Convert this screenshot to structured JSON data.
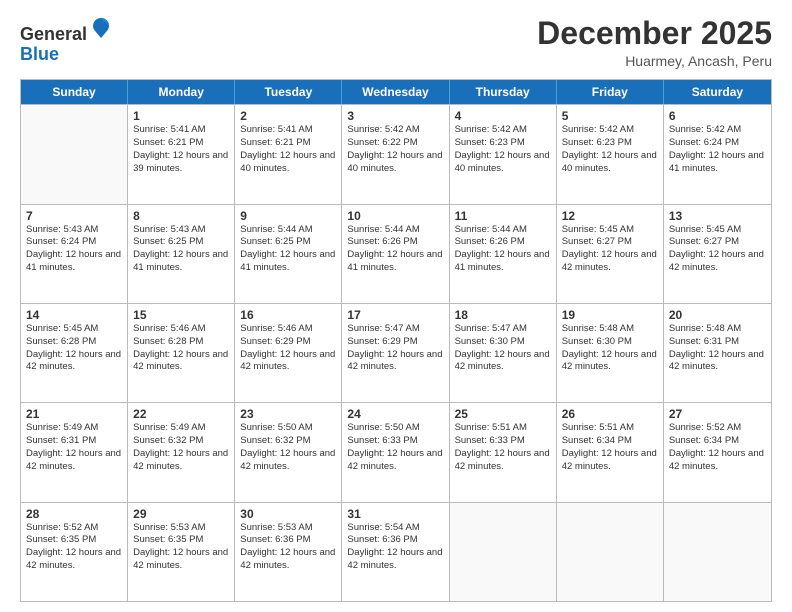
{
  "logo": {
    "general": "General",
    "blue": "Blue"
  },
  "title": "December 2025",
  "location": "Huarmey, Ancash, Peru",
  "days": [
    "Sunday",
    "Monday",
    "Tuesday",
    "Wednesday",
    "Thursday",
    "Friday",
    "Saturday"
  ],
  "weeks": [
    [
      {
        "day": "",
        "sunrise": "",
        "sunset": "",
        "daylight": ""
      },
      {
        "day": "1",
        "sunrise": "Sunrise: 5:41 AM",
        "sunset": "Sunset: 6:21 PM",
        "daylight": "Daylight: 12 hours and 39 minutes."
      },
      {
        "day": "2",
        "sunrise": "Sunrise: 5:41 AM",
        "sunset": "Sunset: 6:21 PM",
        "daylight": "Daylight: 12 hours and 40 minutes."
      },
      {
        "day": "3",
        "sunrise": "Sunrise: 5:42 AM",
        "sunset": "Sunset: 6:22 PM",
        "daylight": "Daylight: 12 hours and 40 minutes."
      },
      {
        "day": "4",
        "sunrise": "Sunrise: 5:42 AM",
        "sunset": "Sunset: 6:23 PM",
        "daylight": "Daylight: 12 hours and 40 minutes."
      },
      {
        "day": "5",
        "sunrise": "Sunrise: 5:42 AM",
        "sunset": "Sunset: 6:23 PM",
        "daylight": "Daylight: 12 hours and 40 minutes."
      },
      {
        "day": "6",
        "sunrise": "Sunrise: 5:42 AM",
        "sunset": "Sunset: 6:24 PM",
        "daylight": "Daylight: 12 hours and 41 minutes."
      }
    ],
    [
      {
        "day": "7",
        "sunrise": "Sunrise: 5:43 AM",
        "sunset": "Sunset: 6:24 PM",
        "daylight": "Daylight: 12 hours and 41 minutes."
      },
      {
        "day": "8",
        "sunrise": "Sunrise: 5:43 AM",
        "sunset": "Sunset: 6:25 PM",
        "daylight": "Daylight: 12 hours and 41 minutes."
      },
      {
        "day": "9",
        "sunrise": "Sunrise: 5:44 AM",
        "sunset": "Sunset: 6:25 PM",
        "daylight": "Daylight: 12 hours and 41 minutes."
      },
      {
        "day": "10",
        "sunrise": "Sunrise: 5:44 AM",
        "sunset": "Sunset: 6:26 PM",
        "daylight": "Daylight: 12 hours and 41 minutes."
      },
      {
        "day": "11",
        "sunrise": "Sunrise: 5:44 AM",
        "sunset": "Sunset: 6:26 PM",
        "daylight": "Daylight: 12 hours and 41 minutes."
      },
      {
        "day": "12",
        "sunrise": "Sunrise: 5:45 AM",
        "sunset": "Sunset: 6:27 PM",
        "daylight": "Daylight: 12 hours and 42 minutes."
      },
      {
        "day": "13",
        "sunrise": "Sunrise: 5:45 AM",
        "sunset": "Sunset: 6:27 PM",
        "daylight": "Daylight: 12 hours and 42 minutes."
      }
    ],
    [
      {
        "day": "14",
        "sunrise": "Sunrise: 5:45 AM",
        "sunset": "Sunset: 6:28 PM",
        "daylight": "Daylight: 12 hours and 42 minutes."
      },
      {
        "day": "15",
        "sunrise": "Sunrise: 5:46 AM",
        "sunset": "Sunset: 6:28 PM",
        "daylight": "Daylight: 12 hours and 42 minutes."
      },
      {
        "day": "16",
        "sunrise": "Sunrise: 5:46 AM",
        "sunset": "Sunset: 6:29 PM",
        "daylight": "Daylight: 12 hours and 42 minutes."
      },
      {
        "day": "17",
        "sunrise": "Sunrise: 5:47 AM",
        "sunset": "Sunset: 6:29 PM",
        "daylight": "Daylight: 12 hours and 42 minutes."
      },
      {
        "day": "18",
        "sunrise": "Sunrise: 5:47 AM",
        "sunset": "Sunset: 6:30 PM",
        "daylight": "Daylight: 12 hours and 42 minutes."
      },
      {
        "day": "19",
        "sunrise": "Sunrise: 5:48 AM",
        "sunset": "Sunset: 6:30 PM",
        "daylight": "Daylight: 12 hours and 42 minutes."
      },
      {
        "day": "20",
        "sunrise": "Sunrise: 5:48 AM",
        "sunset": "Sunset: 6:31 PM",
        "daylight": "Daylight: 12 hours and 42 minutes."
      }
    ],
    [
      {
        "day": "21",
        "sunrise": "Sunrise: 5:49 AM",
        "sunset": "Sunset: 6:31 PM",
        "daylight": "Daylight: 12 hours and 42 minutes."
      },
      {
        "day": "22",
        "sunrise": "Sunrise: 5:49 AM",
        "sunset": "Sunset: 6:32 PM",
        "daylight": "Daylight: 12 hours and 42 minutes."
      },
      {
        "day": "23",
        "sunrise": "Sunrise: 5:50 AM",
        "sunset": "Sunset: 6:32 PM",
        "daylight": "Daylight: 12 hours and 42 minutes."
      },
      {
        "day": "24",
        "sunrise": "Sunrise: 5:50 AM",
        "sunset": "Sunset: 6:33 PM",
        "daylight": "Daylight: 12 hours and 42 minutes."
      },
      {
        "day": "25",
        "sunrise": "Sunrise: 5:51 AM",
        "sunset": "Sunset: 6:33 PM",
        "daylight": "Daylight: 12 hours and 42 minutes."
      },
      {
        "day": "26",
        "sunrise": "Sunrise: 5:51 AM",
        "sunset": "Sunset: 6:34 PM",
        "daylight": "Daylight: 12 hours and 42 minutes."
      },
      {
        "day": "27",
        "sunrise": "Sunrise: 5:52 AM",
        "sunset": "Sunset: 6:34 PM",
        "daylight": "Daylight: 12 hours and 42 minutes."
      }
    ],
    [
      {
        "day": "28",
        "sunrise": "Sunrise: 5:52 AM",
        "sunset": "Sunset: 6:35 PM",
        "daylight": "Daylight: 12 hours and 42 minutes."
      },
      {
        "day": "29",
        "sunrise": "Sunrise: 5:53 AM",
        "sunset": "Sunset: 6:35 PM",
        "daylight": "Daylight: 12 hours and 42 minutes."
      },
      {
        "day": "30",
        "sunrise": "Sunrise: 5:53 AM",
        "sunset": "Sunset: 6:36 PM",
        "daylight": "Daylight: 12 hours and 42 minutes."
      },
      {
        "day": "31",
        "sunrise": "Sunrise: 5:54 AM",
        "sunset": "Sunset: 6:36 PM",
        "daylight": "Daylight: 12 hours and 42 minutes."
      },
      {
        "day": "",
        "sunrise": "",
        "sunset": "",
        "daylight": ""
      },
      {
        "day": "",
        "sunrise": "",
        "sunset": "",
        "daylight": ""
      },
      {
        "day": "",
        "sunrise": "",
        "sunset": "",
        "daylight": ""
      }
    ]
  ]
}
